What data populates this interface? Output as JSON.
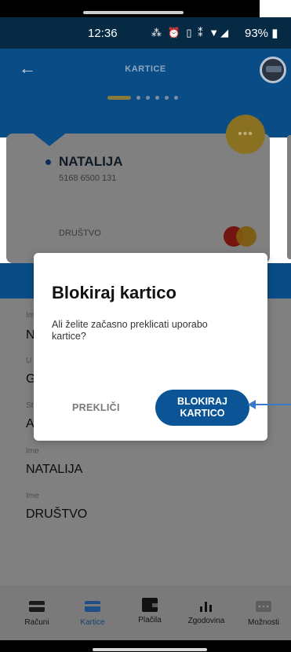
{
  "status_bar": {
    "time": "12:36",
    "icons": "⁂ ⏰ ▯ ⁑ ▼◢",
    "battery": "93%"
  },
  "header": {
    "title": "KARTICE",
    "pager_total": 6,
    "pager_active": 1
  },
  "card": {
    "holder_name": "NATALIJA",
    "number": "5168 6500 131",
    "company": "DRUŠTVO",
    "brand_icon": "mastercard-logo"
  },
  "details": {
    "fields": [
      {
        "label": "Im",
        "value": "N"
      },
      {
        "label": "U",
        "value": "G"
      },
      {
        "label": "St",
        "value": "A"
      },
      {
        "label": "Ime",
        "value": "NATALIJA"
      },
      {
        "label": "Ime",
        "value": "DRUŠTVO"
      }
    ]
  },
  "dialog": {
    "title": "Blokiraj kartico",
    "message": "Ali želite začasno preklicati uporabo kartice?",
    "cancel_label": "PREKLIČI",
    "confirm_label_line1": "BLOKIRAJ",
    "confirm_label_line2": "KARTICO"
  },
  "nav": {
    "items": [
      {
        "label": "Računi",
        "icon": "wallet-card-icon"
      },
      {
        "label": "Kartice",
        "icon": "credit-card-icon",
        "active": true
      },
      {
        "label": "Plačila",
        "icon": "wallet-icon"
      },
      {
        "label": "Zgodovina",
        "icon": "bar-chart-icon"
      },
      {
        "label": "Možnosti",
        "icon": "more-icon"
      }
    ]
  },
  "colors": {
    "primary": "#0a4d86",
    "button": "#0b5596",
    "accent_gold": "#8a7122",
    "annotation_arrow": "#3a78c9"
  }
}
